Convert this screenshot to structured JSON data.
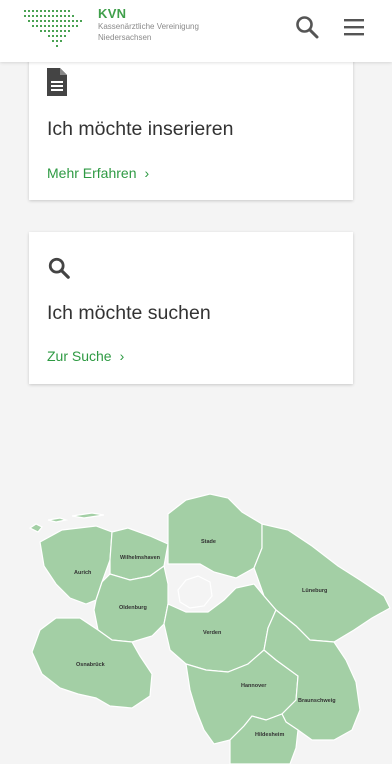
{
  "header": {
    "logo_title": "KVN",
    "logo_subtitle_line1": "Kassenärztliche Vereinigung",
    "logo_subtitle_line2": "Niedersachsen",
    "search_icon": "search-icon",
    "menu_icon": "menu-icon"
  },
  "cards": [
    {
      "icon": "document-icon",
      "title": "Ich möchte inserieren",
      "link": "Mehr Erfahren",
      "link_chevron": "›"
    },
    {
      "icon": "search-icon",
      "title": "Ich möchte suchen",
      "link": "Zur Suche",
      "link_chevron": "›"
    }
  ],
  "map": {
    "regions": [
      "Aurich",
      "Wilhelmshaven",
      "Stade",
      "Oldenburg",
      "Lüneburg",
      "Verden",
      "Osnabrück",
      "Hannover",
      "Braunschweig",
      "Hildesheim"
    ]
  },
  "colors": {
    "brand_green": "#3f9f4a",
    "link_green": "#2e9a43",
    "map_fill": "#a3cfa5",
    "map_border": "#ffffff",
    "background": "#f4f4f4"
  }
}
